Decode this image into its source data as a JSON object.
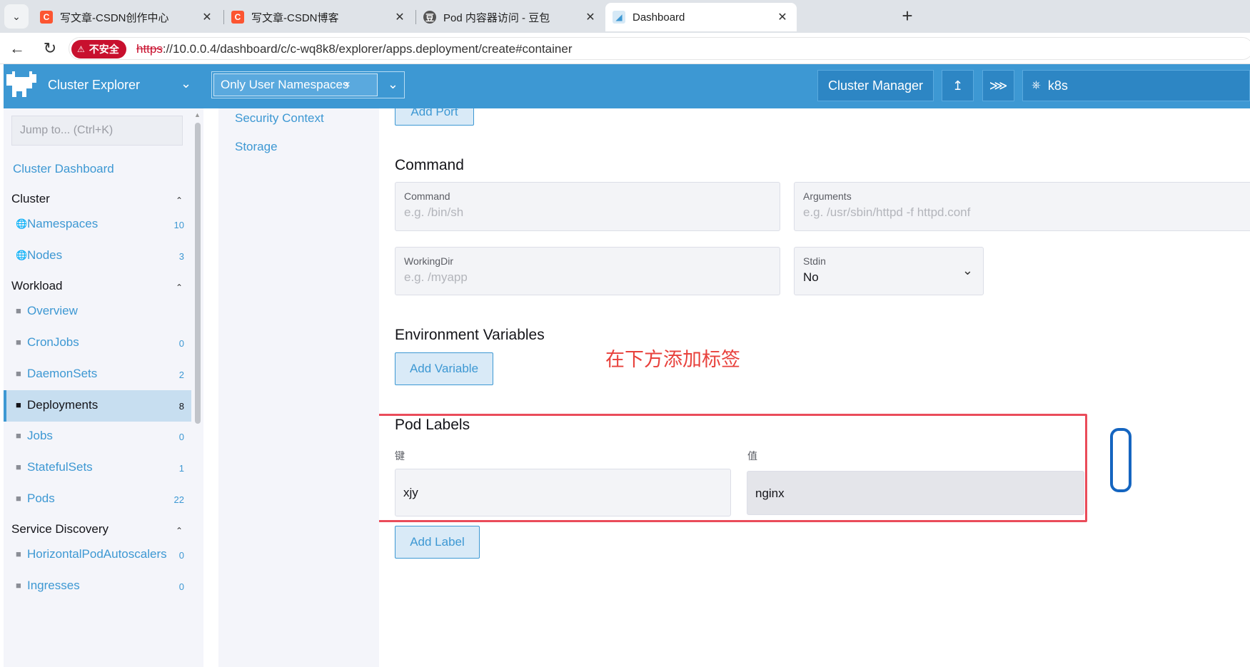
{
  "browser": {
    "tabs": [
      {
        "title": "写文章-CSDN创作中心",
        "favicon": "C",
        "favicon_color": "#fc5531"
      },
      {
        "title": "写文章-CSDN博客",
        "favicon": "C",
        "favicon_color": "#fc5531"
      },
      {
        "title": "Pod 内容器访问 - 豆包",
        "favicon": "豆",
        "favicon_color": "#555555"
      },
      {
        "title": "Dashboard",
        "favicon": "◢",
        "favicon_color": "#3d98d3"
      }
    ],
    "close_glyph": "✕",
    "insecure_label": "不安全",
    "url_protocol": "https",
    "url_rest": "://10.0.0.4/dashboard/c/c-wq8k8/explorer/apps.deployment/create#container"
  },
  "header": {
    "product": "Cluster Explorer",
    "namespace_filter": "Only User Namespaces",
    "cluster_manager": "Cluster Manager",
    "cluster_name": "k8s",
    "accent": "#3d98d3"
  },
  "sidebar": {
    "jump_placeholder": "Jump to... (Ctrl+K)",
    "cluster_dashboard": "Cluster Dashboard",
    "groups": {
      "cluster": "Cluster",
      "workload": "Workload",
      "service_discovery": "Service Discovery"
    },
    "items": {
      "namespaces": {
        "label": "Namespaces",
        "count": "10",
        "icon": "globe-icon"
      },
      "nodes": {
        "label": "Nodes",
        "count": "3",
        "icon": "globe-icon"
      },
      "overview": {
        "label": "Overview",
        "count": "",
        "icon": "folder-icon"
      },
      "cronjobs": {
        "label": "CronJobs",
        "count": "0",
        "icon": "folder-icon"
      },
      "daemonsets": {
        "label": "DaemonSets",
        "count": "2",
        "icon": "folder-icon"
      },
      "deployments": {
        "label": "Deployments",
        "count": "8",
        "icon": "folder-icon"
      },
      "jobs": {
        "label": "Jobs",
        "count": "0",
        "icon": "folder-icon"
      },
      "statefulsets": {
        "label": "StatefulSets",
        "count": "1",
        "icon": "folder-icon"
      },
      "pods": {
        "label": "Pods",
        "count": "22",
        "icon": "folder-icon"
      },
      "hpa": {
        "label": "HorizontalPodAutoscalers",
        "count": "0",
        "icon": "folder-icon"
      },
      "ingresses": {
        "label": "Ingresses",
        "count": "0",
        "icon": "folder-icon"
      }
    }
  },
  "form_tabs": {
    "security_context": "Security Context",
    "storage": "Storage"
  },
  "form": {
    "add_port": "Add Port",
    "command_section": "Command",
    "command_label": "Command",
    "command_placeholder": "e.g. /bin/sh",
    "arguments_label": "Arguments",
    "arguments_placeholder": "e.g. /usr/sbin/httpd -f httpd.conf",
    "workingdir_label": "WorkingDir",
    "workingdir_placeholder": "e.g. /myapp",
    "stdin_label": "Stdin",
    "stdin_value": "No",
    "env_section": "Environment Variables",
    "add_variable": "Add Variable",
    "annotation": "在下方添加标签",
    "pod_labels_section": "Pod Labels",
    "key_label": "键",
    "value_label": "值",
    "key_value": "xjy",
    "value_value": "nginx",
    "add_label": "Add Label",
    "annotation_color": "#e8413c"
  }
}
